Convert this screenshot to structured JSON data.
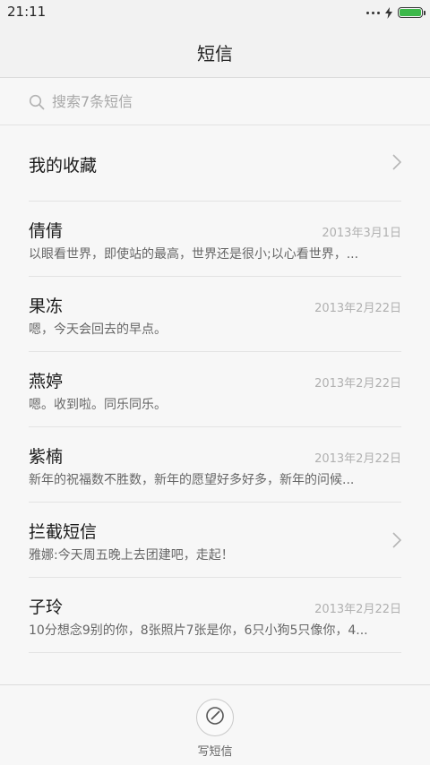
{
  "status_bar": {
    "time": "21:11",
    "battery_level": 1.0,
    "battery_color": "#3cb84a"
  },
  "header": {
    "title": "短信"
  },
  "search": {
    "placeholder": "搜索7条短信"
  },
  "favorites": {
    "label": "我的收藏"
  },
  "messages": [
    {
      "name": "倩倩",
      "date": "2013年3月1日",
      "preview": "以眼看世界，即使站的最高，世界还是很小;以心看世界，..."
    },
    {
      "name": "果冻",
      "date": "2013年2月22日",
      "preview": "嗯，今天会回去的早点。"
    },
    {
      "name": "燕婷",
      "date": "2013年2月22日",
      "preview": "嗯。收到啦。同乐同乐。"
    },
    {
      "name": "紫楠",
      "date": "2013年2月22日",
      "preview": "新年的祝福数不胜数，新年的愿望好多好多，新年的问候..."
    },
    {
      "name": "拦截短信",
      "date": "",
      "preview": "雅娜:今天周五晚上去团建吧，走起！"
    },
    {
      "name": "子玲",
      "date": "2013年2月22日",
      "preview": "10分想念9别的你，8张照片7张是你，6只小狗5只像你，4..."
    }
  ],
  "compose": {
    "label": "写短信",
    "icon": "compose-icon"
  }
}
